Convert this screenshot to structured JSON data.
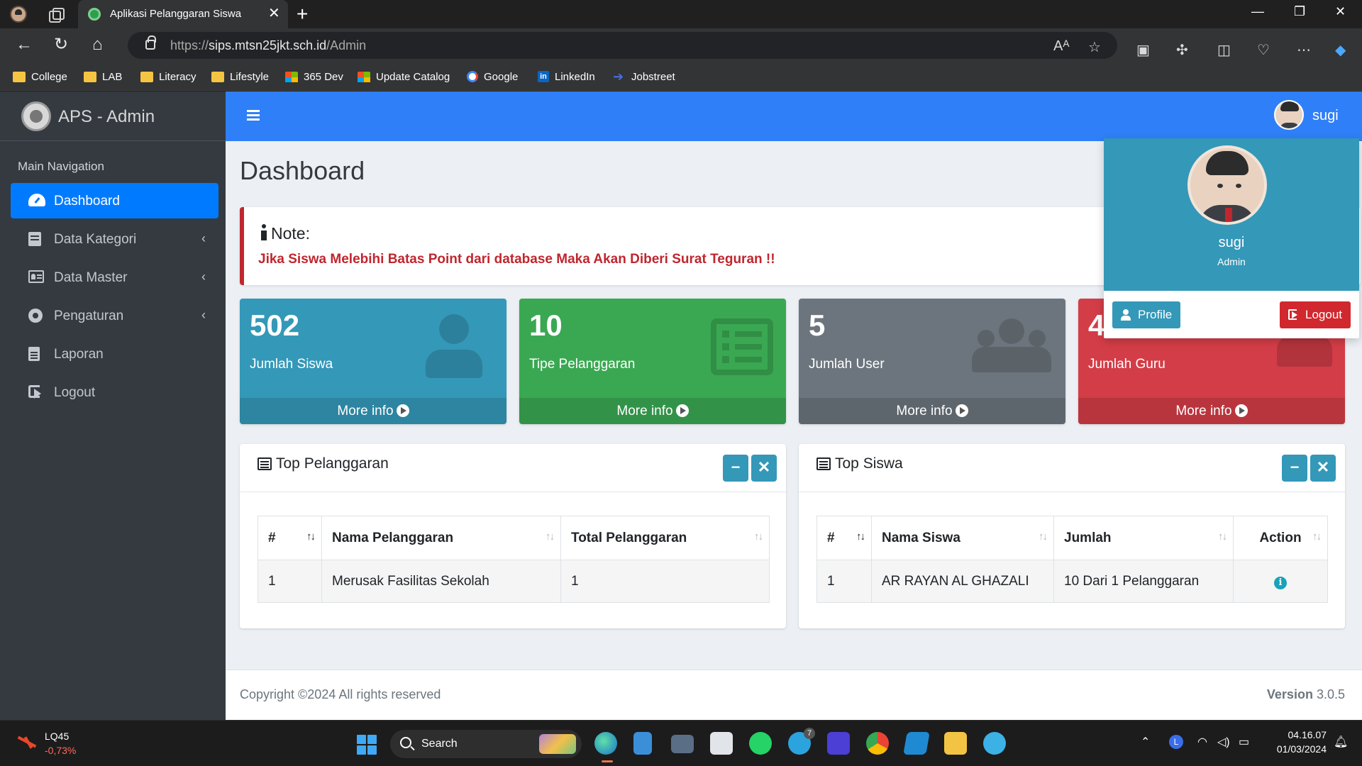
{
  "browser": {
    "tab_title": "Aplikasi Pelanggaran Siswa",
    "url_prefix": "https://",
    "url_host": "sips.mtsn25jkt.sch.id",
    "url_path": "/Admin",
    "bookmarks": [
      "College",
      "LAB",
      "Literacy",
      "Lifestyle",
      "365 Dev",
      "Update Catalog",
      "Google",
      "LinkedIn",
      "Jobstreet"
    ]
  },
  "brand": {
    "title": "APS - Admin"
  },
  "sidebar": {
    "header": "Main Navigation",
    "items": [
      {
        "label": "Dashboard",
        "icon": "tachometer-icon",
        "active": true
      },
      {
        "label": "Data Kategori",
        "icon": "book-icon",
        "has_submenu": true
      },
      {
        "label": "Data Master",
        "icon": "id-card-icon",
        "has_submenu": true
      },
      {
        "label": "Pengaturan",
        "icon": "gear-icon",
        "has_submenu": true
      },
      {
        "label": "Laporan",
        "icon": "file-icon"
      },
      {
        "label": "Logout",
        "icon": "sign-out-icon"
      }
    ]
  },
  "topnav": {
    "user_name": "sugi"
  },
  "page": {
    "title": "Dashboard"
  },
  "note": {
    "title": "Note:",
    "text": "Jika Siswa Melebihi Batas Point dari database Maka Akan Diberi Surat Teguran !!"
  },
  "stats": [
    {
      "value": "502",
      "label": "Jumlah Siswa",
      "more": "More info",
      "color": "#3498b8",
      "icon": "user-icon"
    },
    {
      "value": "10",
      "label": "Tipe Pelanggaran",
      "more": "More info",
      "color": "#3aa852",
      "icon": "list-icon"
    },
    {
      "value": "5",
      "label": "Jumlah User",
      "more": "More info",
      "color": "#6c757d",
      "icon": "users-icon"
    },
    {
      "value": "4",
      "label": "Jumlah Guru",
      "more": "More info",
      "color": "#d33d47",
      "icon": "teacher-icon"
    }
  ],
  "top_pelanggaran": {
    "title": "Top Pelanggaran",
    "columns": [
      "#",
      "Nama Pelanggaran",
      "Total Pelanggaran"
    ],
    "rows": [
      [
        "1",
        "Merusak Fasilitas Sekolah",
        "1"
      ]
    ]
  },
  "top_siswa": {
    "title": "Top Siswa",
    "columns": [
      "#",
      "Nama Siswa",
      "Jumlah",
      "Action"
    ],
    "rows": [
      [
        "1",
        "AR RAYAN AL GHAZALI",
        "10 Dari 1 Pelanggaran"
      ]
    ]
  },
  "user_dropdown": {
    "name": "sugi",
    "role": "Admin",
    "profile_label": "Profile",
    "logout_label": "Logout"
  },
  "footer": {
    "copyright": "Copyright ©2024 All rights reserved",
    "version_label": "Version",
    "version_value": "3.0.5"
  },
  "taskbar": {
    "stock_name": "LQ45",
    "stock_change": "-0,73%",
    "search_label": "Search",
    "telegram_badge": "7",
    "time": "04.16.07",
    "date": "01/03/2024"
  },
  "colors": {
    "primary": "#2f7ff8",
    "sidebar": "#343a40",
    "accent_teal": "#3498b8",
    "danger": "#c0262e"
  }
}
